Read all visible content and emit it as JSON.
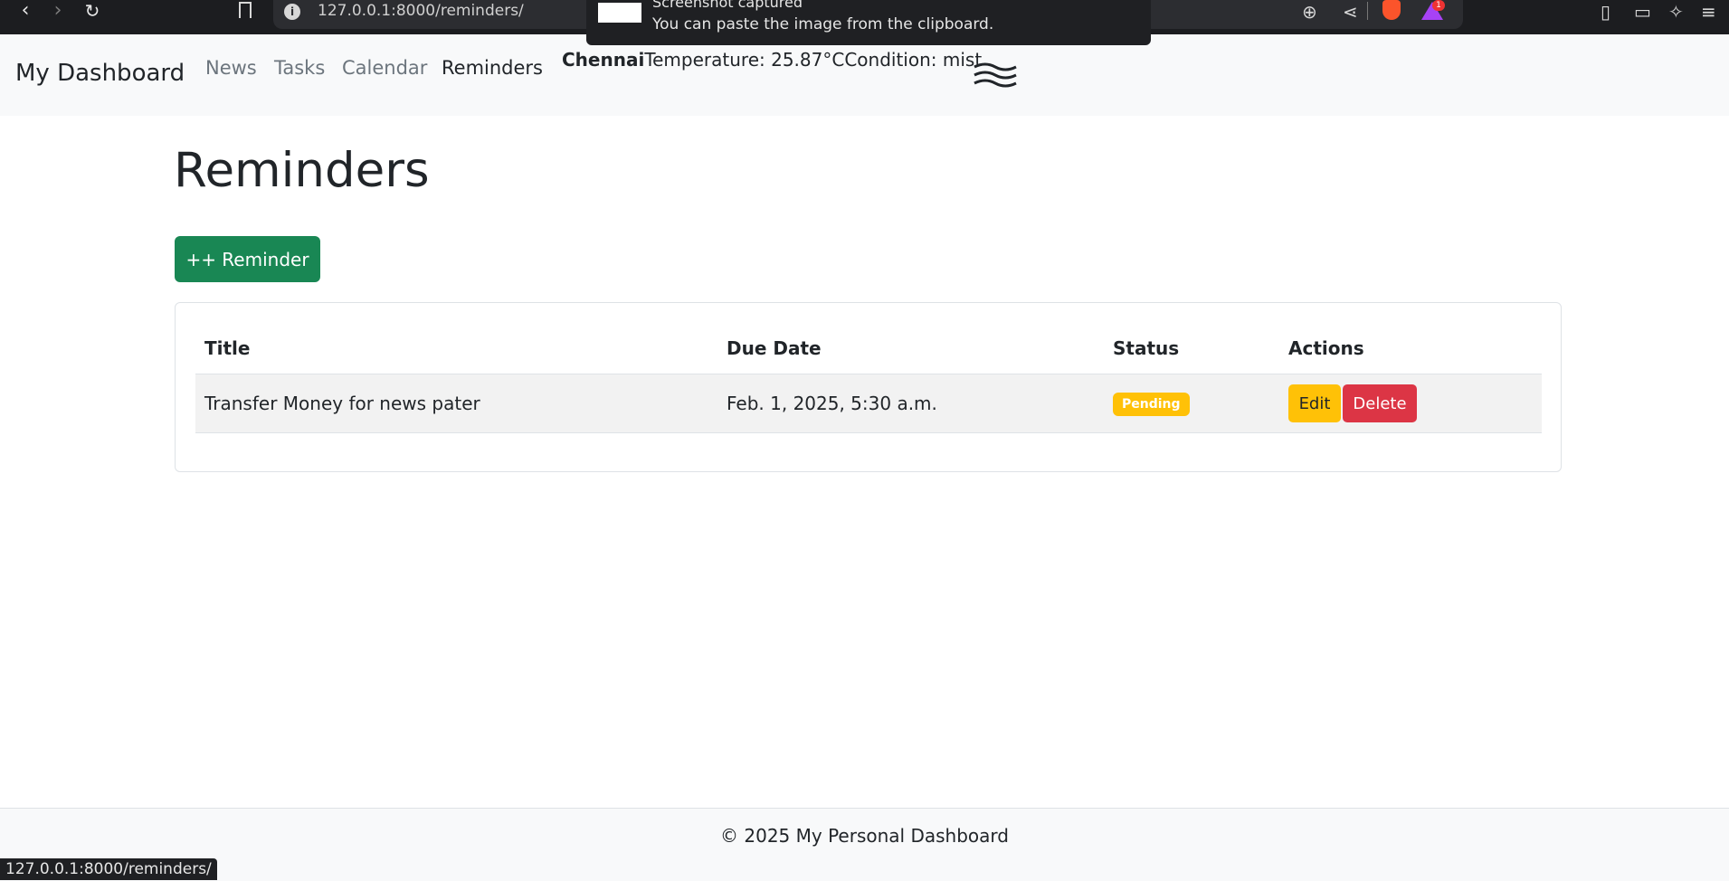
{
  "browser": {
    "url": "127.0.0.1:8000/reminders/",
    "status_url": "127.0.0.1:8000/reminders/",
    "rewards_count": "1",
    "icons": [
      "back-icon",
      "forward-icon",
      "reload-icon",
      "bookmark-icon",
      "info-icon",
      "zoom-icon",
      "share-icon",
      "brave-shield-icon",
      "rewards-icon",
      "sidebar-icon",
      "wallet-icon",
      "leo-icon",
      "menu-icon"
    ]
  },
  "toast": {
    "title": "Screenshot captured",
    "message": "You can paste the image from the clipboard."
  },
  "navbar": {
    "brand": "My Dashboard",
    "links": [
      "News",
      "Tasks",
      "Calendar",
      "Reminders"
    ],
    "active": "Reminders",
    "weather": {
      "city": "Chennai",
      "temperature": "Temperature: 25.87°C",
      "condition": "Condition: mist",
      "icon": "mist-icon"
    }
  },
  "main": {
    "title": "Reminders",
    "add_button": "++ Reminder",
    "table": {
      "headers": [
        "Title",
        "Due Date",
        "Status",
        "Actions"
      ],
      "rows": [
        {
          "title": "Transfer Money for news pater",
          "due_date": "Feb. 1, 2025, 5:30 a.m.",
          "status": "Pending",
          "edit_label": "Edit",
          "delete_label": "Delete"
        }
      ]
    }
  },
  "footer": {
    "text": "© 2025 My Personal Dashboard"
  },
  "colors": {
    "primary_success": "#198754",
    "warning": "#ffc107",
    "danger": "#dc3545",
    "navbar_bg": "#f8f9fa"
  }
}
